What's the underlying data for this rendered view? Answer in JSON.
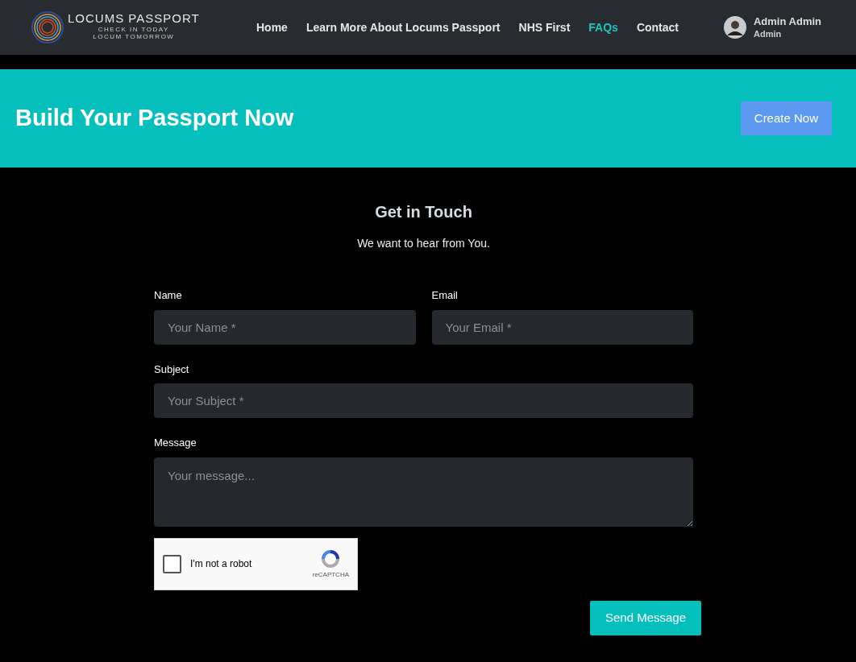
{
  "header": {
    "logo": {
      "title": "LOCUMS PASSPORT",
      "tagline_1": "CHECK IN TODAY",
      "tagline_2": "LOCUM TOMORROW"
    },
    "nav": [
      {
        "label": "Home",
        "selected": false
      },
      {
        "label": "Learn More About Locums Passport",
        "selected": false
      },
      {
        "label": "NHS First",
        "selected": false
      },
      {
        "label": "FAQs",
        "selected": true
      },
      {
        "label": "Contact",
        "selected": false
      }
    ],
    "user": {
      "name": "Admin Admin",
      "role": "Admin"
    }
  },
  "banner": {
    "title": "Build Your Passport Now",
    "button": "Create Now"
  },
  "contact": {
    "title": "Get in Touch",
    "subtitle": "We want to hear from You.",
    "fields": [
      {
        "label": "Name",
        "placeholder": "Your Name *",
        "kind": "input"
      },
      {
        "label": "Email",
        "placeholder": "Your Email *",
        "kind": "input"
      },
      {
        "label": "Subject",
        "placeholder": "Your Subject *",
        "kind": "input"
      },
      {
        "label": "Message",
        "placeholder": "Your message...",
        "kind": "textarea"
      }
    ],
    "captcha": {
      "label": "I'm not a robot",
      "brand": "reCAPTCHA",
      "checked": false
    },
    "button": "Send Message"
  }
}
